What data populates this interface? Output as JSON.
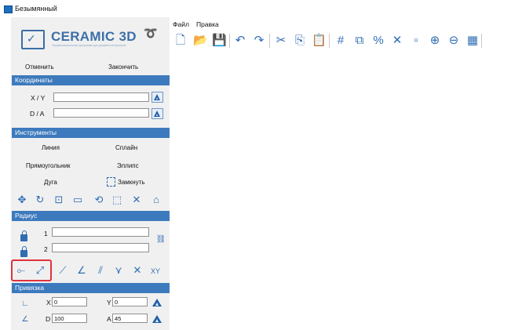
{
  "window": {
    "title": "Безымянный"
  },
  "logo": {
    "name": "CERAMIC 3D",
    "tagline": "Профессиональная программа для дизайна интерьеров"
  },
  "menu": [
    {
      "label": "Файл"
    },
    {
      "label": "Правка"
    }
  ],
  "actions": {
    "undo_label": "Отменить",
    "finish_label": "Закончить"
  },
  "coordinates": {
    "header": "Координаты",
    "xy_label": "X / Y",
    "da_label": "D / A",
    "xy_value": "",
    "da_value": ""
  },
  "tools": {
    "header": "Инструменты",
    "line": "Линия",
    "spline": "Сплайн",
    "rectangle": "Прямоугольник",
    "ellipse": "Эллипс",
    "arc": "Дуга",
    "close": "Замкнуть"
  },
  "radius": {
    "header": "Радиус",
    "r1_label": "1",
    "r2_label": "2",
    "r1_value": "",
    "r2_value": ""
  },
  "snap_toolbar": {
    "xy_label": "XY"
  },
  "binding": {
    "header": "Привязка",
    "x_label": "X",
    "y_label": "Y",
    "d_label": "D",
    "a_label": "A",
    "x_value": "0",
    "y_value": "0",
    "d_value": "100",
    "a_value": "45"
  },
  "colors": {
    "section_header": "#3d7abd",
    "icon_blue": "#2f6db3",
    "highlight_red": "#e0323c",
    "panel_bg": "#f0f0f0"
  }
}
